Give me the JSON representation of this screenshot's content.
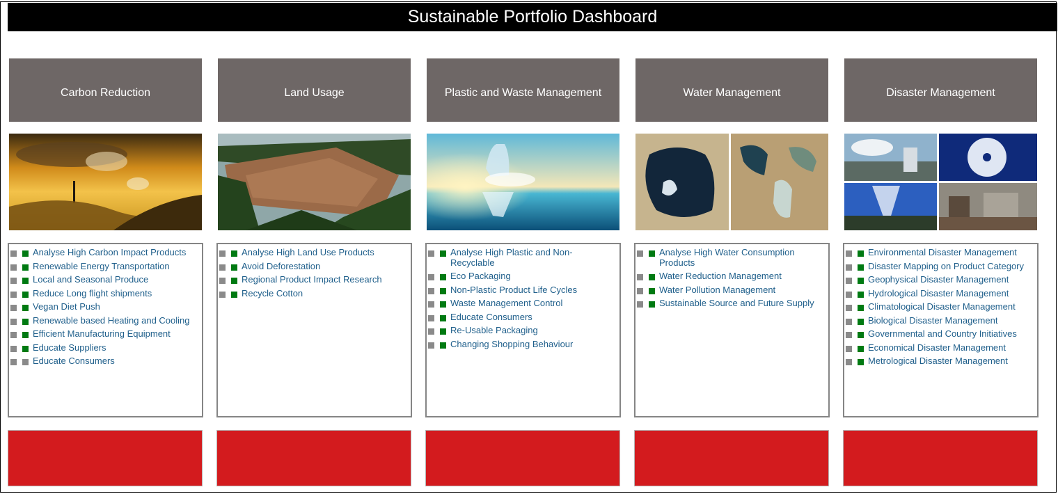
{
  "title": "Sustainable Portfolio Dashboard",
  "columns": [
    {
      "id": "carbon",
      "header": "Carbon Reduction",
      "image": "smokestack-sunset-image",
      "items": [
        {
          "label": "Analyse High Carbon Impact Products",
          "status": "green"
        },
        {
          "label": "Renewable Energy Transportation",
          "status": "green"
        },
        {
          "label": "Local and Seasonal Produce",
          "status": "green"
        },
        {
          "label": "Reduce Long flight shipments",
          "status": "green"
        },
        {
          "label": "Vegan Diet Push",
          "status": "green"
        },
        {
          "label": "Renewable based Heating and Cooling",
          "status": "green"
        },
        {
          "label": "Efficient Manufacturing Equipment",
          "status": "green"
        },
        {
          "label": "Educate Suppliers",
          "status": "green"
        },
        {
          "label": "Educate Consumers",
          "status": "gray"
        }
      ]
    },
    {
      "id": "land",
      "header": "Land Usage",
      "image": "deforestation-image",
      "items": [
        {
          "label": "Analyse High Land Use Products",
          "status": "green"
        },
        {
          "label": "Avoid Deforestation",
          "status": "green"
        },
        {
          "label": "Regional Product Impact Research",
          "status": "green"
        },
        {
          "label": "Recycle Cotton",
          "status": "green"
        }
      ]
    },
    {
      "id": "plastic",
      "header": "Plastic and Waste Management",
      "image": "plastic-bottle-ocean-image",
      "items": [
        {
          "label": "Analyse High Plastic and Non-Recyclable",
          "status": "green"
        },
        {
          "label": "Eco Packaging",
          "status": "green"
        },
        {
          "label": "Non-Plastic Product Life Cycles",
          "status": "green"
        },
        {
          "label": "Waste Management Control",
          "status": "green"
        },
        {
          "label": "Educate Consumers",
          "status": "green"
        },
        {
          "label": "Re-Usable Packaging",
          "status": "green"
        },
        {
          "label": "Changing Shopping Behaviour",
          "status": "green"
        }
      ]
    },
    {
      "id": "water",
      "header": "Water Management",
      "image": "aral-sea-comparison-image",
      "items": [
        {
          "label": "Analyse High Water Consumption Products",
          "status": "green"
        },
        {
          "label": "Water Reduction Management",
          "status": "green"
        },
        {
          "label": "Water Pollution Management",
          "status": "green"
        },
        {
          "label": "Sustainable Source and Future Supply",
          "status": "green"
        }
      ]
    },
    {
      "id": "disaster",
      "header": "Disaster Management",
      "image": "disaster-collage-image",
      "items": [
        {
          "label": "Environmental Disaster Management",
          "status": "green"
        },
        {
          "label": "Disaster Mapping on Product Category",
          "status": "green"
        },
        {
          "label": "Geophysical Disaster Management",
          "status": "green"
        },
        {
          "label": "Hydrological Disaster Management",
          "status": "green"
        },
        {
          "label": "Climatological Disaster Management",
          "status": "green"
        },
        {
          "label": "Biological Disaster Management",
          "status": "green"
        },
        {
          "label": "Governmental and Country Initiatives",
          "status": "green"
        },
        {
          "label": "Economical Disaster Management",
          "status": "green"
        },
        {
          "label": "Metrological Disaster Management",
          "status": "green"
        }
      ]
    }
  ],
  "colors": {
    "title_bg": "#000000",
    "header_bg": "#6e6766",
    "item_text": "#1f5f8b",
    "status_green": "#007a12",
    "status_gray": "#8a8a8a",
    "footer_red": "#d31b1e"
  }
}
